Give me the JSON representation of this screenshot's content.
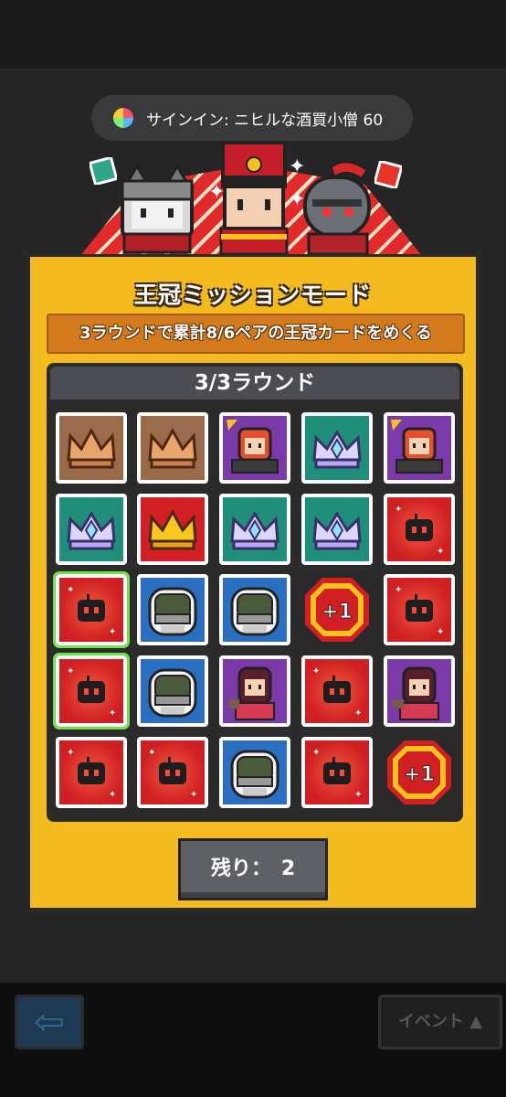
{
  "notification": {
    "text": "サインイン: ニヒルな酒買小僧 60",
    "icon": "game-center-icon"
  },
  "panel": {
    "title": "王冠ミッションモード",
    "mission": "3ラウンドで累計8/6ペアの王冠カードをめくる",
    "round": "3/3ラウンド",
    "remaining": "残り：　2"
  },
  "cards": [
    [
      "crown-bronze",
      "crown-bronze",
      "character-red-girl",
      "crown-diamond",
      "character-red-girl"
    ],
    [
      "crown-diamond",
      "crown-gold",
      "crown-diamond",
      "crown-diamond",
      "card-back"
    ],
    [
      "card-back",
      "character-astronaut",
      "character-astronaut",
      "plus-one",
      "card-back"
    ],
    [
      "card-back",
      "character-astronaut",
      "character-purple-girl",
      "card-back",
      "character-purple-girl"
    ],
    [
      "card-back",
      "card-back",
      "character-astronaut",
      "card-back",
      "plus-one"
    ]
  ],
  "selected_cards": [
    [
      2,
      0
    ],
    [
      3,
      0
    ]
  ],
  "plus_one_label": "+1",
  "footer": {
    "back_icon": "back-arrow-icon",
    "event_label": "イベント"
  },
  "colors": {
    "panel": "#f4bb1e",
    "mission_bar": "#d27a1c",
    "board": "#2b2b2b",
    "card_back": "#e8322a",
    "selected_outline": "#6ee64a"
  }
}
